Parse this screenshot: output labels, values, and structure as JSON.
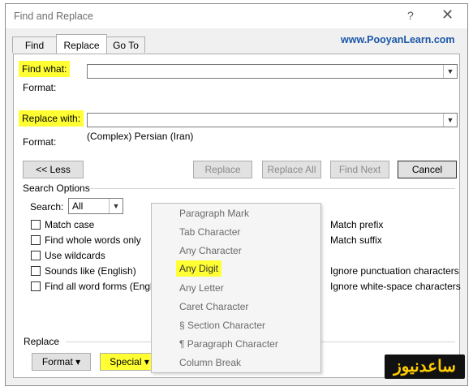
{
  "window": {
    "title": "Find and Replace",
    "help": "?",
    "close": "✕"
  },
  "tabs": [
    {
      "label": "Find"
    },
    {
      "label": "Replace"
    },
    {
      "label": "Go To"
    }
  ],
  "brand": "www.PooyanLearn.com",
  "find": {
    "label": "Find what:",
    "value": "",
    "format_label": "Format:"
  },
  "replace": {
    "label": "Replace with:",
    "value": "",
    "format_label": "Format:",
    "format_value": "(Complex) Persian (Iran)"
  },
  "buttons": {
    "less": "<< Less",
    "replace": "Replace",
    "replace_all": "Replace All",
    "find_next": "Find Next",
    "cancel": "Cancel"
  },
  "search_options": {
    "header": "Search Options",
    "search_label": "Search:",
    "search_value": "All"
  },
  "checkboxes_left": [
    {
      "label": "Match case"
    },
    {
      "label": "Find whole words only"
    },
    {
      "label": "Use wildcards"
    },
    {
      "label": "Sounds like (English)"
    },
    {
      "label": "Find all word forms (English)"
    }
  ],
  "checkboxes_right": [
    {
      "label": "Match prefix"
    },
    {
      "label": "Match suffix"
    },
    {
      "label": "Ignore punctuation characters"
    },
    {
      "label": "Ignore white-space characters"
    }
  ],
  "bottom": {
    "header": "Replace",
    "format_button": "Format ▾",
    "special_button": "Special ▾"
  },
  "special_menu": [
    {
      "label": "Paragraph Mark"
    },
    {
      "label": "Tab Character"
    },
    {
      "label": "Any Character"
    },
    {
      "label": "Any Digit"
    },
    {
      "label": "Any Letter"
    },
    {
      "label": "Caret Character"
    },
    {
      "label": "§ Section Character"
    },
    {
      "label": "¶ Paragraph Character"
    },
    {
      "label": "Column Break"
    }
  ],
  "watermark": "ساعدنیوز",
  "colors": {
    "highlight": "#ffff33",
    "brand": "#1a56a7",
    "dialog_bg": "#f0f0f0"
  }
}
